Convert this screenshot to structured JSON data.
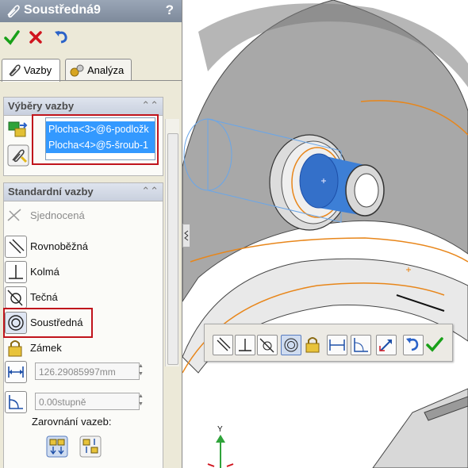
{
  "window": {
    "title": "Soustředná9",
    "help": "?"
  },
  "actions": {
    "ok": "ok-icon",
    "cancel": "cancel-icon",
    "undo": "undo-icon"
  },
  "tabs": [
    {
      "label": "Vazby",
      "icon": "paperclip-icon",
      "active": true
    },
    {
      "label": "Analýza",
      "icon": "analysis-icon",
      "active": false
    }
  ],
  "selections_group": {
    "title": "Výběry vazby",
    "items": [
      "Plocha<3>@6-podložk",
      "Plocha<4>@5-šroub-1"
    ]
  },
  "standard_group": {
    "title": "Standardní vazby",
    "mates": [
      {
        "label": "Sjednocená",
        "icon": "coincident-icon",
        "enabled": false
      },
      {
        "label": "Rovnoběžná",
        "icon": "parallel-icon",
        "enabled": true
      },
      {
        "label": "Kolmá",
        "icon": "perpendicular-icon",
        "enabled": true
      },
      {
        "label": "Tečná",
        "icon": "tangent-icon",
        "enabled": true
      },
      {
        "label": "Soustředná",
        "icon": "concentric-icon",
        "enabled": true,
        "selected": true
      },
      {
        "label": "Zámek",
        "icon": "lock-icon",
        "enabled": true
      }
    ],
    "distance_value": "126.29085997mm",
    "angle_value": "0.00stupně",
    "alignment_label": "Zarovnání vazeb:"
  },
  "context_toolbar": {
    "buttons": [
      "parallel-icon",
      "perpendicular-icon",
      "tangent-icon",
      "concentric-icon",
      "lock-icon",
      "distance-icon",
      "angle-icon",
      "flip-icon",
      "undo-icon",
      "ok-icon"
    ],
    "selected": "concentric-icon"
  },
  "axis": {
    "y_label": "Y"
  },
  "colors": {
    "accent_blue": "#3399ff",
    "highlight_red": "#c0141c",
    "edge_orange": "#e8861a",
    "part_blue": "#3d7fd6"
  }
}
